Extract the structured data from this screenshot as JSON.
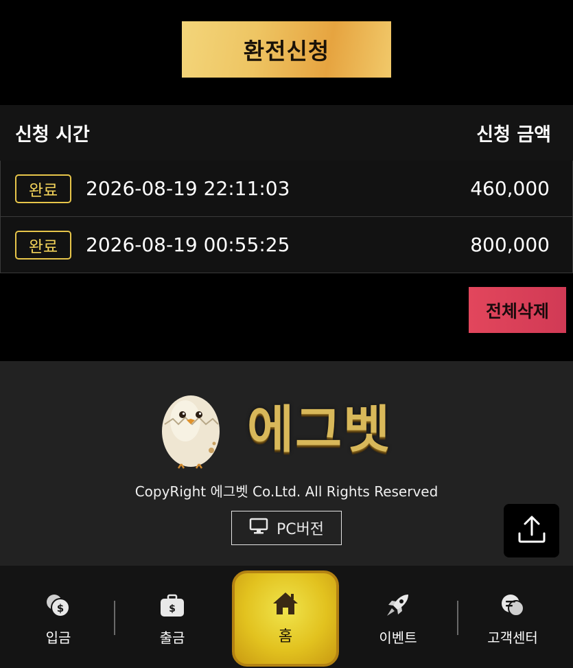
{
  "header": {
    "exchange_button": "환전신청"
  },
  "table": {
    "col_time": "신청 시간",
    "col_amount": "신청 금액",
    "rows": [
      {
        "status": "완료",
        "time": "2026-08-19 22:11:03",
        "amount": "460,000"
      },
      {
        "status": "완료",
        "time": "2026-08-19 00:55:25",
        "amount": "800,000"
      }
    ]
  },
  "actions": {
    "delete_all": "전체삭제"
  },
  "footer": {
    "logo_text": "에그벳",
    "copyright": "CopyRight 에그벳 Co.Ltd. All Rights Reserved",
    "pc_version": "PC버전"
  },
  "nav": {
    "deposit": "입금",
    "withdraw": "출금",
    "home": "홈",
    "event": "이벤트",
    "support": "고객센터"
  },
  "colors": {
    "gold": "#e8c64a",
    "delete": "#dc4258",
    "home": "#e2c21f"
  },
  "icons": [
    "coin-icon",
    "briefcase-dollar-icon",
    "home-icon",
    "rocket-icon",
    "chat-bubble-icon",
    "monitor-icon",
    "upload-icon"
  ]
}
